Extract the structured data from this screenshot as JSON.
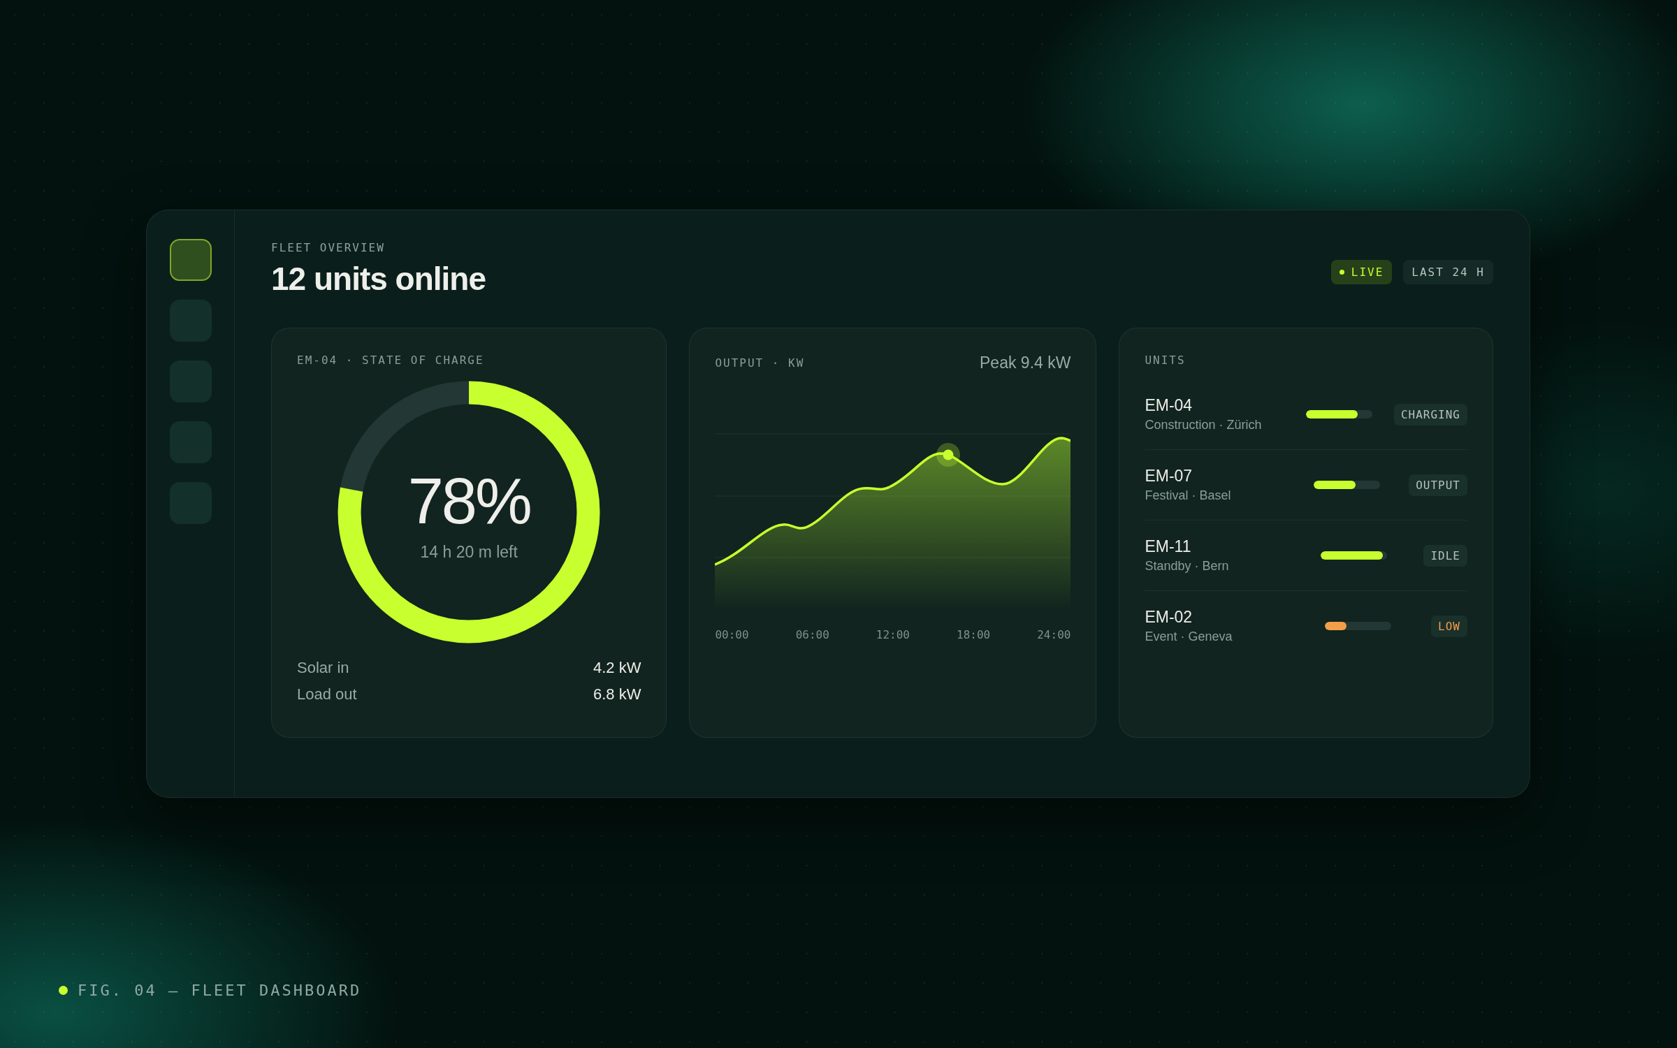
{
  "sidebar": {
    "items": [
      {
        "selected": true
      },
      {
        "selected": false
      },
      {
        "selected": false
      },
      {
        "selected": false
      },
      {
        "selected": false
      }
    ]
  },
  "header": {
    "eyebrow": "FLEET OVERVIEW",
    "title": "12 units online",
    "live": {
      "label": "LIVE",
      "on": true
    },
    "range": "LAST 24 H"
  },
  "charge_card": {
    "label": "EM-04 · STATE OF CHARGE",
    "level": 0.78,
    "percent": "78%",
    "remaining": "14 h 20 m left",
    "stats": [
      {
        "label": "Solar in",
        "value": "4.2 kW"
      },
      {
        "label": "Load out",
        "value": "6.8 kW"
      }
    ]
  },
  "output_card": {
    "label": "OUTPUT · KW",
    "peak": "Peak 9.4 kW",
    "x_labels": [
      "00:00",
      "06:00",
      "12:00",
      "18:00",
      "24:00"
    ]
  },
  "units_card": {
    "label": "UNITS",
    "units": [
      {
        "name": "EM-04",
        "detail": "Construction · Zürich",
        "level": 0.78,
        "color": "#c8ff2e",
        "status": "CHARGING",
        "alert": false
      },
      {
        "name": "EM-07",
        "detail": "Festival · Basel",
        "level": 0.63,
        "color": "#c8ff2e",
        "status": "OUTPUT",
        "alert": false
      },
      {
        "name": "EM-11",
        "detail": "Standby · Bern",
        "level": 0.93,
        "color": "#c8ff2e",
        "status": "IDLE",
        "alert": false
      },
      {
        "name": "EM-02",
        "detail": "Event · Geneva",
        "level": 0.33,
        "color": "#f59e4a",
        "status": "LOW",
        "alert": true
      }
    ]
  },
  "caption": "FIG. 04 — FLEET DASHBOARD"
}
